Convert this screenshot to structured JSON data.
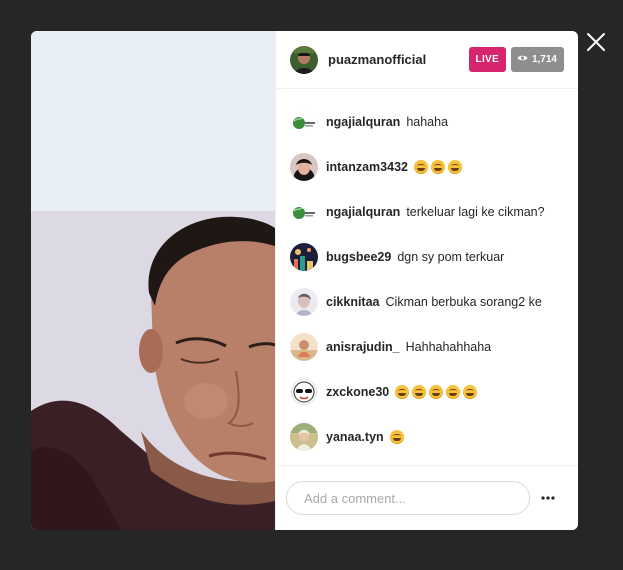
{
  "host": {
    "username": "puazmanofficial",
    "live_label": "LIVE",
    "viewer_count": "1,714"
  },
  "comments": [
    {
      "user": "ngajialquran",
      "text": "hahaha",
      "emoji_count": 0,
      "avatar": "logo-globe"
    },
    {
      "user": "intanzam3432",
      "text": "",
      "emoji_count": 3,
      "avatar": "hijab-woman"
    },
    {
      "user": "ngajialquran",
      "text": "terkeluar lagi ke cikman?",
      "emoji_count": 0,
      "avatar": "logo-globe"
    },
    {
      "user": "bugsbee29",
      "text": "dgn sy pom terkuar",
      "emoji_count": 0,
      "avatar": "night-city"
    },
    {
      "user": "cikknitaa",
      "text": "Cikman berbuka sorang2 ke",
      "emoji_count": 0,
      "avatar": "light-portrait"
    },
    {
      "user": "anisrajudin_",
      "text": "Hahhahahhaha",
      "emoji_count": 0,
      "avatar": "beach-person"
    },
    {
      "user": "zxckone30",
      "text": "",
      "emoji_count": 5,
      "avatar": "cartoon-sunglasses"
    },
    {
      "user": "yanaa.tyn",
      "text": "",
      "emoji_count": 1,
      "avatar": "outdoor-portrait"
    }
  ],
  "footer": {
    "placeholder": "Add a comment..."
  },
  "icons": {
    "close": "close-icon",
    "eye": "eye-icon",
    "more": "more-options-icon",
    "emoji": "tears-of-joy-emoji"
  },
  "colors": {
    "live_badge": "#d6246e",
    "viewer_badge": "#8e8e8e",
    "backdrop": "#262626"
  }
}
